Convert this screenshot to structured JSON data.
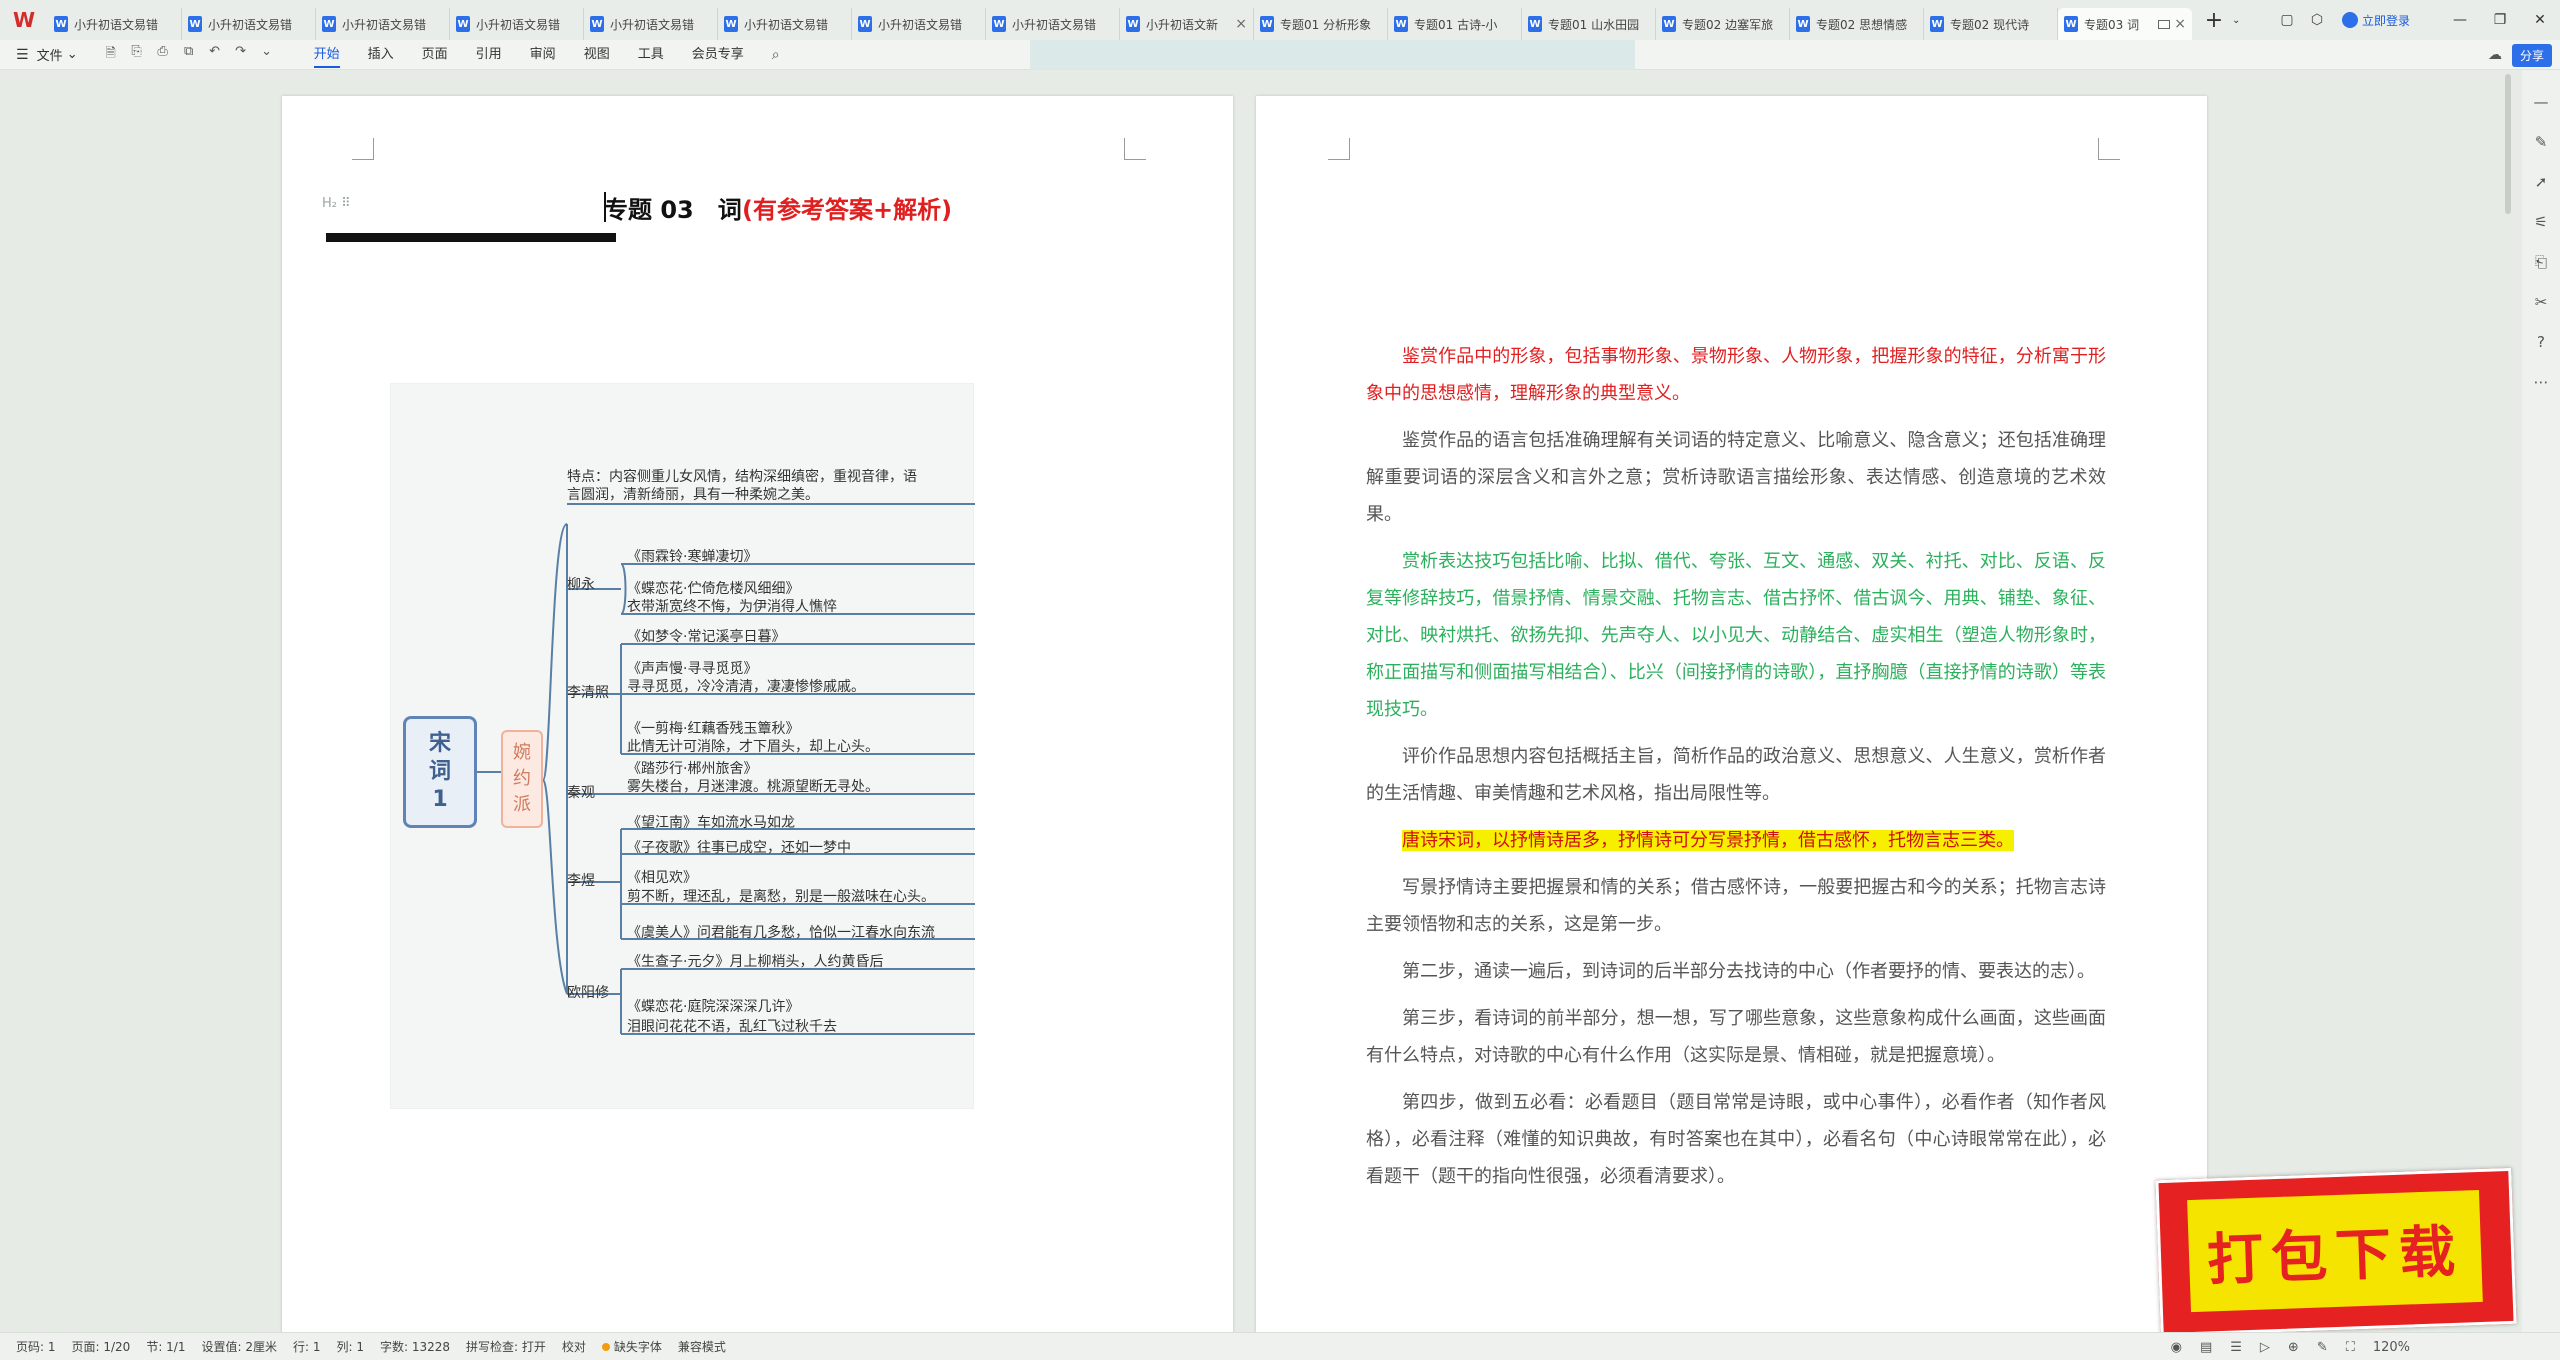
{
  "app": {
    "logo": "W"
  },
  "tabs": [
    {
      "label": "小升初语文易错",
      "active": false
    },
    {
      "label": "小升初语文易错",
      "active": false
    },
    {
      "label": "小升初语文易错",
      "active": false
    },
    {
      "label": "小升初语文易错",
      "active": false
    },
    {
      "label": "小升初语文易错",
      "active": false
    },
    {
      "label": "小升初语文易错",
      "active": false
    },
    {
      "label": "小升初语文易错",
      "active": false
    },
    {
      "label": "小升初语文易错",
      "active": false
    },
    {
      "label": "小升初语文新",
      "active": false
    },
    {
      "label": "专题01 分析形象",
      "active": false
    },
    {
      "label": "专题01 古诗-小",
      "active": false
    },
    {
      "label": "专题01 山水田园",
      "active": false
    },
    {
      "label": "专题02 边塞军旅",
      "active": false
    },
    {
      "label": "专题02 思想情感",
      "active": false
    },
    {
      "label": "专题02 现代诗",
      "active": false
    },
    {
      "label": "专题03 词",
      "active": true
    }
  ],
  "topbar": {
    "login": "立即登录",
    "share": "分享"
  },
  "ribbon": {
    "file_menu": "文件",
    "tabs": [
      "开始",
      "插入",
      "页面",
      "引用",
      "审阅",
      "视图",
      "工具",
      "会员专享"
    ],
    "active_tab": "开始"
  },
  "document": {
    "heading_marker": "H₂ ⠿",
    "title_black": "专题 03　词",
    "title_red": "(有参考答案+解析)"
  },
  "mindmap": {
    "root": "宋词1",
    "branch": "婉约派",
    "nodes": [
      {
        "text": "特点：内容侧重儿女风情，结构深细缜密，重视音律，语"
      },
      {
        "text": "言圆润，清新绮丽，具有一种柔婉之美。"
      },
      {
        "text": "《雨霖铃·寒蝉凄切》"
      },
      {
        "text": "《蝶恋花·伫倚危楼风细细》"
      },
      {
        "text": "衣带渐宽终不悔，为伊消得人憔悴"
      },
      {
        "text": "《如梦令·常记溪亭日暮》"
      },
      {
        "text": "《声声慢·寻寻觅觅》"
      },
      {
        "text": "寻寻觅觅，冷冷清清，凄凄惨惨戚戚。"
      },
      {
        "text": "《一剪梅·红藕香残玉簟秋》"
      },
      {
        "text": "此情无计可消除，才下眉头，却上心头。"
      },
      {
        "text": "《踏莎行·郴州旅舍》"
      },
      {
        "text": "雾失楼台，月迷津渡。桃源望断无寻处。"
      },
      {
        "text": "《望江南》车如流水马如龙"
      },
      {
        "text": "《子夜歌》往事已成空，还如一梦中"
      },
      {
        "text": "《相见欢》"
      },
      {
        "text": "剪不断，理还乱，是离愁，别是一般滋味在心头。"
      },
      {
        "text": "《虞美人》问君能有几多愁，恰似一江春水向东流"
      },
      {
        "text": "《生查子·元夕》月上柳梢头，人约黄昏后"
      },
      {
        "text": "《蝶恋花·庭院深深深几许》"
      },
      {
        "text": "泪眼问花花不语，乱红飞过秋千去"
      }
    ],
    "authors": [
      "柳永",
      "李清照",
      "秦观",
      "李煜",
      "欧阳修"
    ]
  },
  "right_page": {
    "p1": "鉴赏作品中的形象，包括事物形象、景物形象、人物形象，把握形象的特征，分析寓于形象中的思想感情，理解形象的典型意义。",
    "p2": "鉴赏作品的语言包括准确理解有关词语的特定意义、比喻意义、隐含意义；还包括准确理解重要词语的深层含义和言外之意；赏析诗歌语言描绘形象、表达情感、创造意境的艺术效果。",
    "p3": "赏析表达技巧包括比喻、比拟、借代、夸张、互文、通感、双关、衬托、对比、反语、反复等修辞技巧，借景抒情、情景交融、托物言志、借古抒怀、借古讽今、用典、铺垫、象征、对比、映衬烘托、欲扬先抑、先声夺人、以小见大、动静结合、虚实相生（塑造人物形象时，称正面描写和侧面描写相结合）、比兴（间接抒情的诗歌），直抒胸臆（直接抒情的诗歌）等表现技巧。",
    "p4": "评价作品思想内容包括概括主旨，简析作品的政治意义、思想意义、人生意义，赏析作者的生活情趣、审美情趣和艺术风格，指出局限性等。",
    "p5": "唐诗宋词，以抒情诗居多，抒情诗可分写景抒情，借古感怀，托物言志三类。",
    "p6": "写景抒情诗主要把握景和情的关系；借古感怀诗，一般要把握古和今的关系；托物言志诗主要领悟物和志的关系，这是第一步。",
    "p7": "第二步，通读一遍后，到诗词的后半部分去找诗的中心（作者要抒的情、要表达的志）。",
    "p8": "第三步，看诗词的前半部分，想一想，写了哪些意象，这些意象构成什么画面，这些画面有什么特点，对诗歌的中心有什么作用（这实际是景、情相碰，就是把握意境）。",
    "p9": "第四步，做到五必看：必看题目（题目常常是诗眼，或中心事件），必看作者（知作者风格），必看注释（难懂的知识典故，有时答案也在其中），必看名句（中心诗眼常常在此），必看题干（题干的指向性很强，必须看清要求）。"
  },
  "badge": {
    "text": "打包下载"
  },
  "status": {
    "page": "页码: 1",
    "pages": "页面: 1/20",
    "section": "节: 1/1",
    "setting": "设置值: 2厘米",
    "row": "行: 1",
    "col": "列: 1",
    "words": "字数: 13228",
    "spell": "拼写检查: 打开",
    "proof": "校对",
    "missing_font": "缺失字体",
    "compat": "兼容模式",
    "zoom": "120%"
  },
  "colors": {
    "accent": "#1a5ae0",
    "title_red": "#e02020",
    "green": "#2bb05c",
    "highlight": "#f6f000"
  }
}
